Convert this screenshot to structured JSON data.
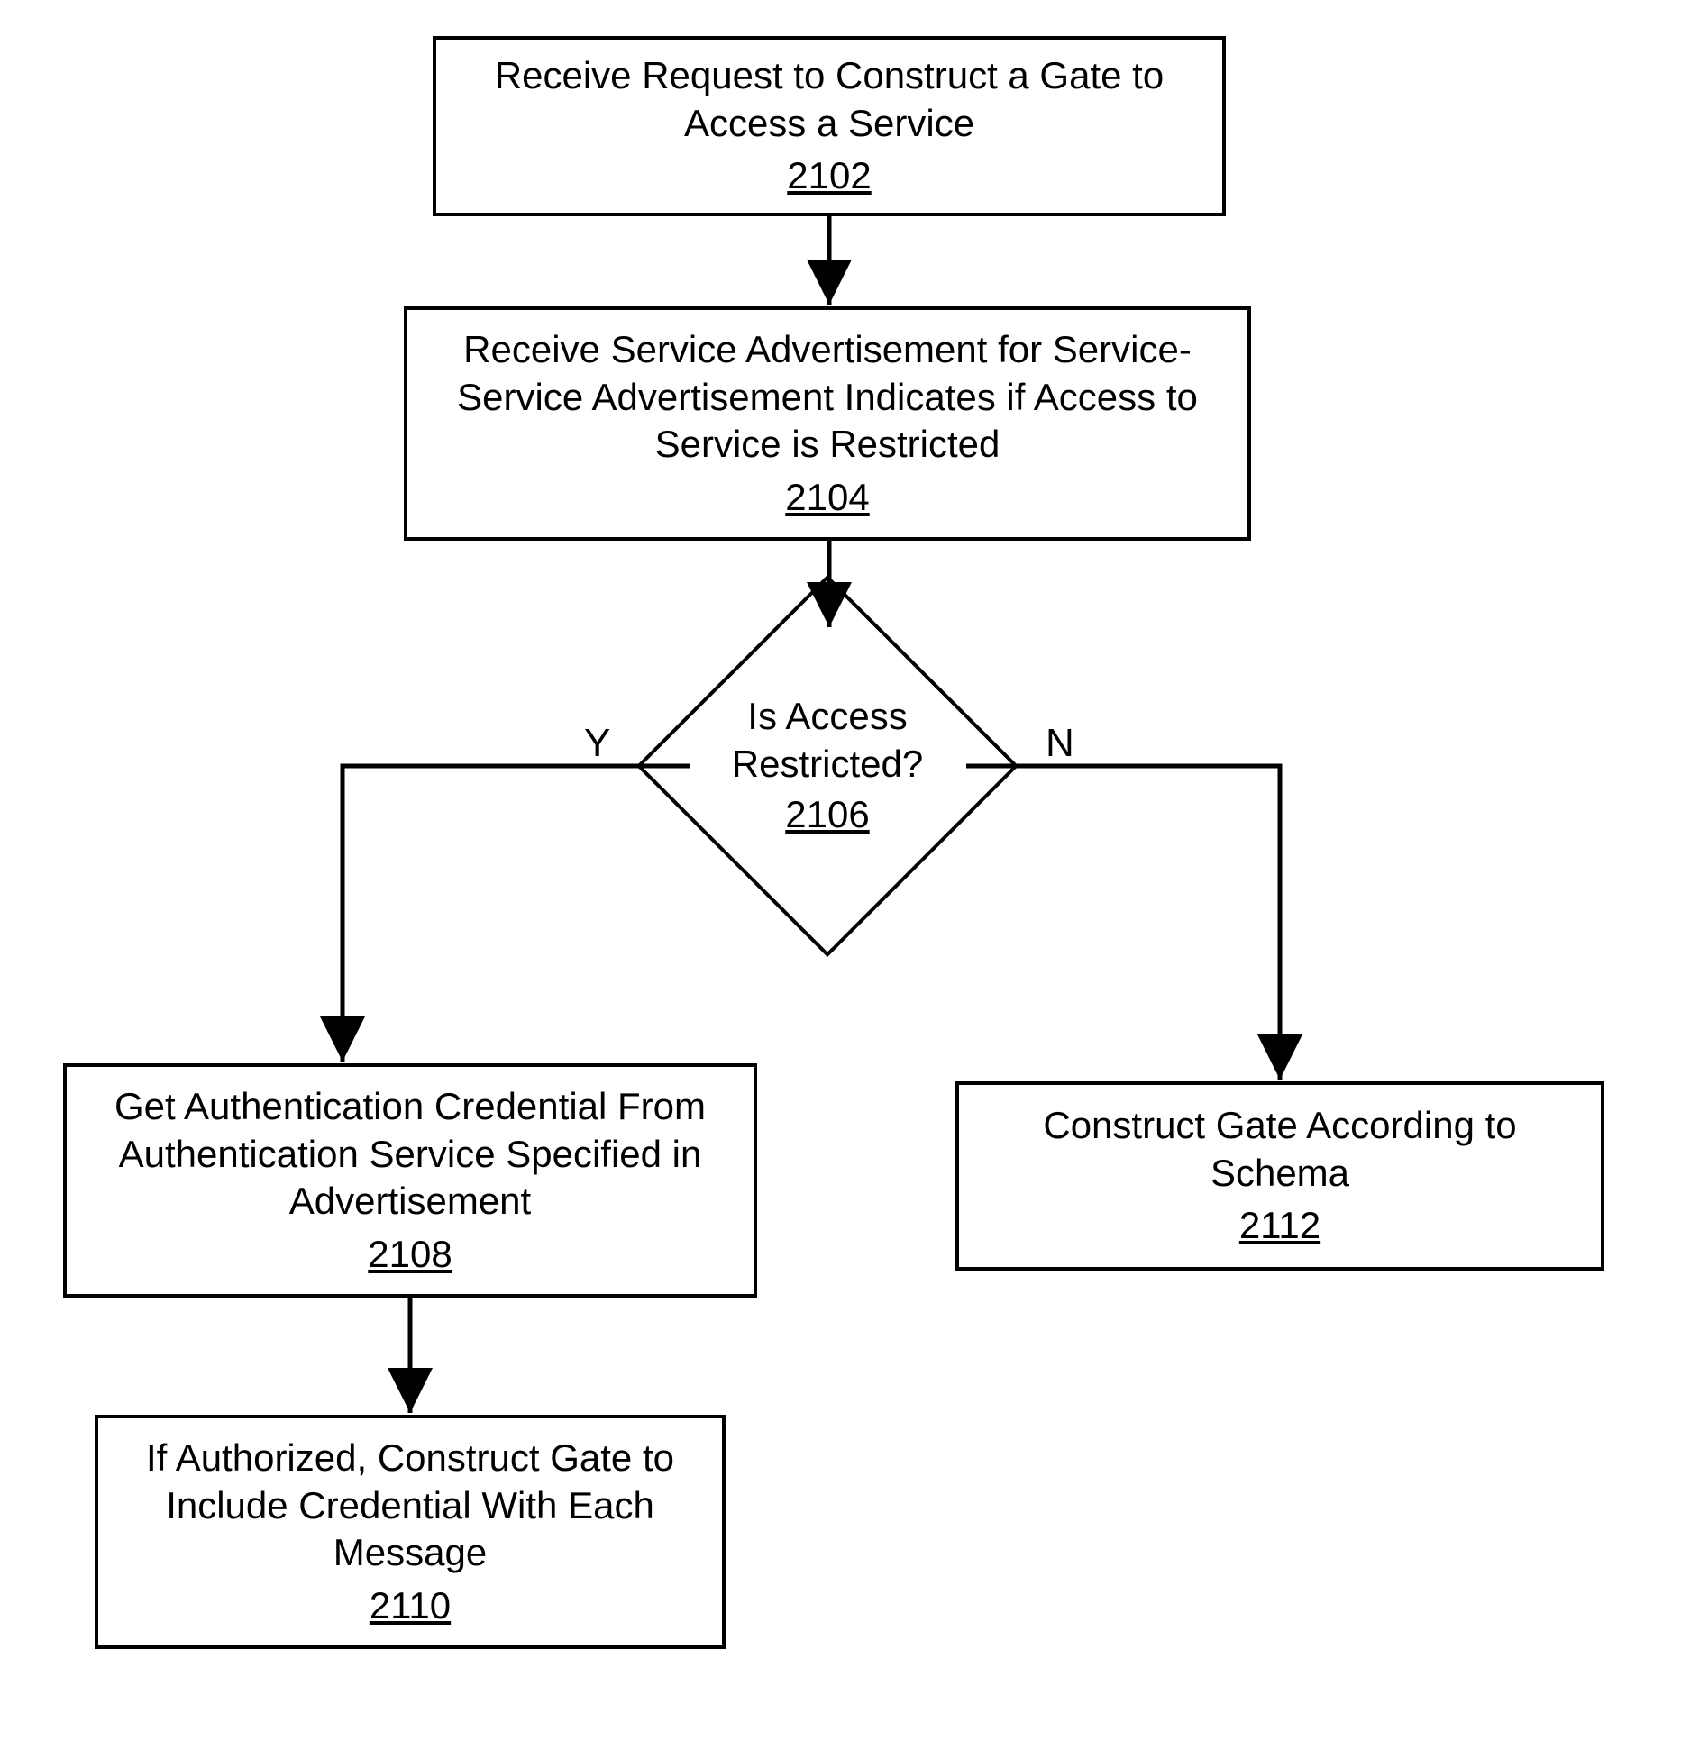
{
  "chart_data": {
    "type": "flowchart",
    "nodes": [
      {
        "id": "2102",
        "type": "process",
        "text": "Receive Request to Construct a Gate to Access a Service",
        "ref": "2102"
      },
      {
        "id": "2104",
        "type": "process",
        "text": "Receive Service Advertisement for Service- Service Advertisement Indicates if Access to Service is Restricted",
        "ref": "2104"
      },
      {
        "id": "2106",
        "type": "decision",
        "text": "Is Access Restricted?",
        "ref": "2106"
      },
      {
        "id": "2108",
        "type": "process",
        "text": "Get Authentication Credential From Authentication Service Specified in Advertisement",
        "ref": "2108"
      },
      {
        "id": "2110",
        "type": "process",
        "text": "If Authorized, Construct Gate to Include Credential With Each Message",
        "ref": "2110"
      },
      {
        "id": "2112",
        "type": "process",
        "text": "Construct Gate According to Schema",
        "ref": "2112"
      }
    ],
    "edges": [
      {
        "from": "2102",
        "to": "2104",
        "label": ""
      },
      {
        "from": "2104",
        "to": "2106",
        "label": ""
      },
      {
        "from": "2106",
        "to": "2108",
        "label": "Y"
      },
      {
        "from": "2106",
        "to": "2112",
        "label": "N"
      },
      {
        "from": "2108",
        "to": "2110",
        "label": ""
      }
    ]
  },
  "nodes": {
    "n2102": {
      "line1": "Receive Request to Construct a Gate to",
      "line2": "Access a Service",
      "ref": "2102"
    },
    "n2104": {
      "line1": "Receive Service Advertisement for Service-",
      "line2": "Service Advertisement Indicates if Access to",
      "line3": "Service is Restricted",
      "ref": "2104"
    },
    "n2106": {
      "line1": "Is Access",
      "line2": "Restricted?",
      "ref": "2106"
    },
    "n2108": {
      "line1": "Get Authentication Credential From",
      "line2": "Authentication Service Specified in",
      "line3": "Advertisement",
      "ref": "2108"
    },
    "n2110": {
      "line1": "If Authorized, Construct Gate to",
      "line2": "Include Credential With Each",
      "line3": "Message",
      "ref": "2110"
    },
    "n2112": {
      "line1": "Construct Gate According to",
      "line2": "Schema",
      "ref": "2112"
    }
  },
  "labels": {
    "yes": "Y",
    "no": "N"
  }
}
